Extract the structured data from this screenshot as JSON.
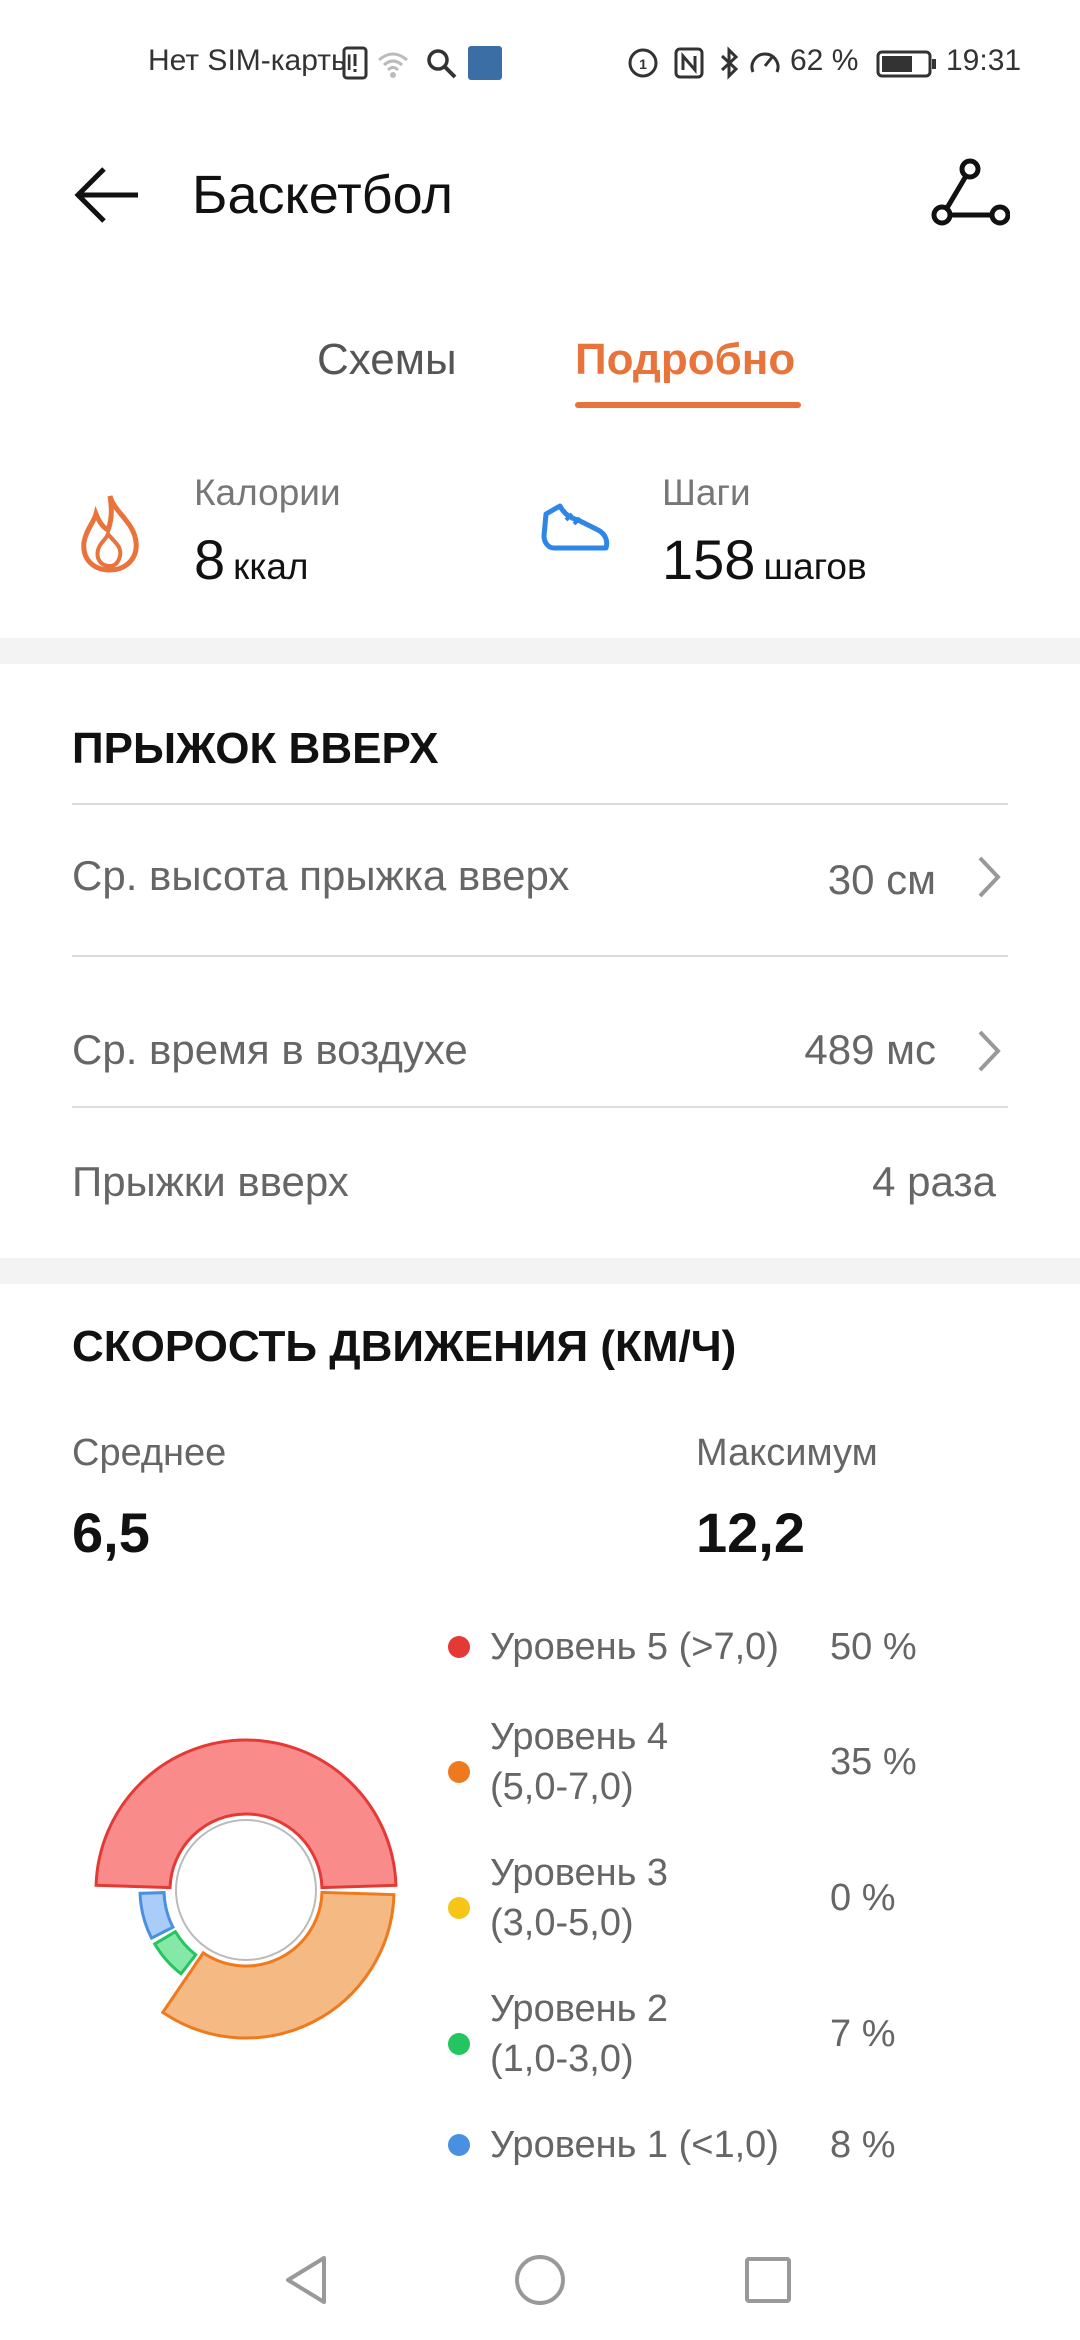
{
  "status_bar": {
    "carrier": "Нет SIM-карты",
    "battery": "62 %",
    "time": "19:31"
  },
  "header": {
    "title": "Баскетбол"
  },
  "tabs": [
    {
      "label": "Схемы",
      "active": false
    },
    {
      "label": "Подробно",
      "active": true
    }
  ],
  "summary": {
    "calories": {
      "label": "Калории",
      "value": "8",
      "unit": "ккал"
    },
    "steps": {
      "label": "Шаги",
      "value": "158",
      "unit": "шагов"
    }
  },
  "jump": {
    "title": "ПРЫЖОК ВВЕРХ",
    "rows": [
      {
        "label": "Ср. высота прыжка вверх",
        "value": "30 см"
      },
      {
        "label": "Ср. время в воздухе",
        "value": "489 мс"
      },
      {
        "label": "Прыжки вверх",
        "value": "4 раза"
      }
    ]
  },
  "speed": {
    "title": "СКОРОСТЬ ДВИЖЕНИЯ (КМ/Ч)",
    "average_label": "Среднее",
    "average_value": "6,5",
    "max_label": "Максимум",
    "max_value": "12,2",
    "levels": [
      {
        "line1": "Уровень 5 (>7,0)",
        "line2": "",
        "pct": "50 %",
        "color": "#E53935"
      },
      {
        "line1": "Уровень 4",
        "line2": "(5,0-7,0)",
        "pct": "35 %",
        "color": "#EF7A1E"
      },
      {
        "line1": "Уровень 3",
        "line2": "(3,0-5,0)",
        "pct": "0 %",
        "color": "#F5C518"
      },
      {
        "line1": "Уровень 2",
        "line2": "(1,0-3,0)",
        "pct": "7 %",
        "color": "#22C55E"
      },
      {
        "line1": "Уровень 1 (<1,0)",
        "line2": "",
        "pct": "8 %",
        "color": "#4A90E2"
      }
    ]
  },
  "chart_data": {
    "type": "pie",
    "categories": [
      "Уровень 5 (>7,0)",
      "Уровень 4 (5,0-7,0)",
      "Уровень 3 (3,0-5,0)",
      "Уровень 2 (1,0-3,0)",
      "Уровень 1 (<1,0)"
    ],
    "values": [
      50,
      35,
      0,
      7,
      8
    ],
    "colors": [
      "#F98B8B",
      "#F5B984",
      "#F5D66E",
      "#86E8A8",
      "#A9CCF8"
    ]
  },
  "colors": {
    "accent": "#E8743B",
    "steps_icon": "#2D86E8"
  }
}
